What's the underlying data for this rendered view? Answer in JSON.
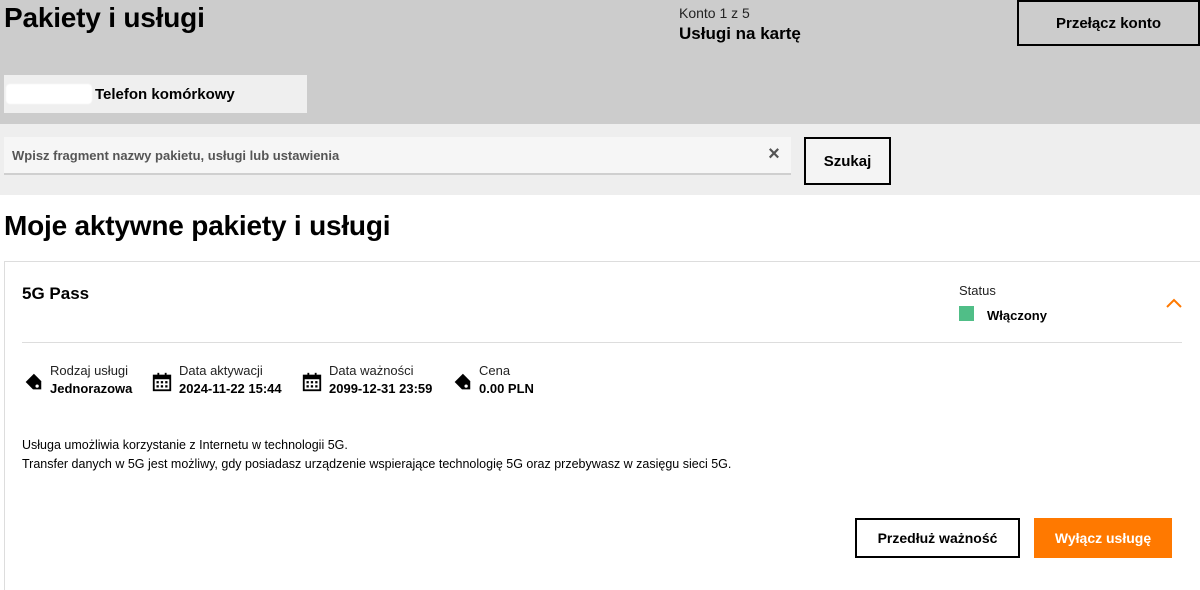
{
  "header": {
    "title": "Pakiety i usługi",
    "account_counter": "Konto 1 z 5",
    "account_name": "Usługi na kartę",
    "switch_account_label": "Przełącz konto"
  },
  "line_tab": {
    "label": "Telefon komórkowy"
  },
  "search": {
    "placeholder": "Wpisz fragment nazwy pakietu, usługi lub ustawienia",
    "value": "",
    "clear_icon": "×",
    "button_label": "Szukaj"
  },
  "section": {
    "title": "Moje aktywne pakiety i usługi"
  },
  "package": {
    "name": "5G Pass",
    "status_label": "Status",
    "status_value": "Włączony",
    "status_color": "#50be87",
    "meta": [
      {
        "icon": "tag-icon",
        "label": "Rodzaj usługi",
        "value": "Jednorazowa"
      },
      {
        "icon": "calendar-icon",
        "label": "Data aktywacji",
        "value": "2024-11-22 15:44"
      },
      {
        "icon": "calendar-icon",
        "label": "Data ważności",
        "value": "2099-12-31 23:59"
      },
      {
        "icon": "tag-icon",
        "label": "Cena",
        "value": "0.00 PLN"
      }
    ],
    "description": [
      "Usługa umożliwia korzystanie z Internetu w technologii 5G.",
      "Transfer danych w 5G jest możliwy, gdy posiadasz urządzenie wspierające technologię 5G oraz przebywasz w zasięgu sieci 5G."
    ],
    "extend_label": "Przedłuż ważność",
    "disable_label": "Wyłącz usługę"
  },
  "colors": {
    "accent": "#ff7900",
    "header_bg": "#cccccc",
    "search_bg": "#eeeeee"
  }
}
